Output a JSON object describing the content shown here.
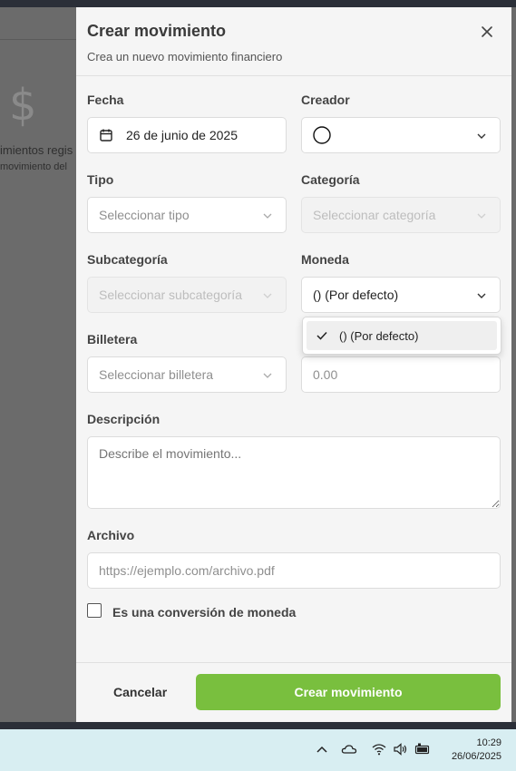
{
  "background": {
    "text1": "imientos regis",
    "text2": "movimiento del"
  },
  "panel": {
    "title": "Crear movimiento",
    "subtitle": "Crea un nuevo movimiento financiero"
  },
  "fields": {
    "fecha": {
      "label": "Fecha",
      "value": "26 de junio de 2025"
    },
    "creador": {
      "label": "Creador"
    },
    "tipo": {
      "label": "Tipo",
      "placeholder": "Seleccionar tipo"
    },
    "categoria": {
      "label": "Categoría",
      "placeholder": "Seleccionar categoría"
    },
    "subcategoria": {
      "label": "Subcategoría",
      "placeholder": "Seleccionar subcategoría"
    },
    "moneda": {
      "label": "Moneda",
      "value": "() (Por defecto)"
    },
    "billetera": {
      "label": "Billetera",
      "placeholder": "Seleccionar billetera"
    },
    "monto": {
      "placeholder": "0.00"
    },
    "descripcion": {
      "label": "Descripción",
      "placeholder": "Describe el movimiento..."
    },
    "archivo": {
      "label": "Archivo",
      "placeholder": "https://ejemplo.com/archivo.pdf"
    },
    "conversion": {
      "label": "Es una conversión de moneda"
    }
  },
  "moneda_dropdown": {
    "options": [
      {
        "label": "() (Por defecto)",
        "selected": true
      }
    ]
  },
  "footer": {
    "cancel_label": "Cancelar",
    "create_label": "Crear movimiento"
  },
  "taskbar": {
    "time": "10:29",
    "date": "26/06/2025"
  },
  "colors": {
    "accent": "#79bf3e"
  }
}
